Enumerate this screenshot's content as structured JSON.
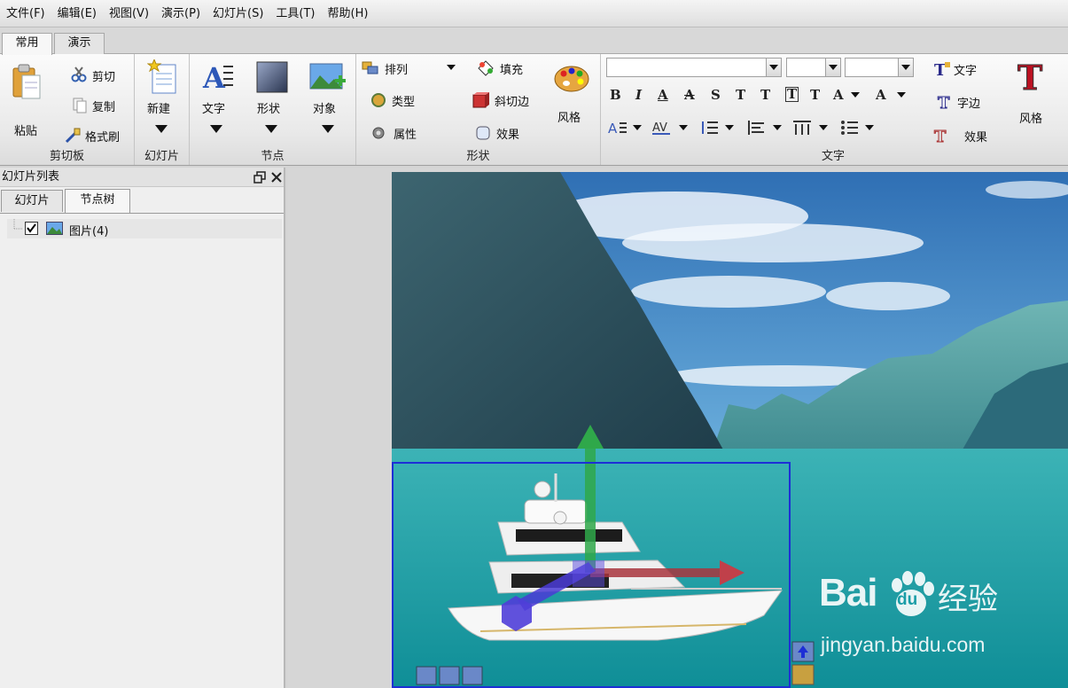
{
  "menu": [
    "文件(F)",
    "编辑(E)",
    "视图(V)",
    "演示(P)",
    "幻灯片(S)",
    "工具(T)",
    "帮助(H)"
  ],
  "ribbon_tabs": [
    "常用",
    "演示"
  ],
  "groups": {
    "clipboard": {
      "label": "剪切板",
      "paste": "粘贴",
      "cut": "剪切",
      "copy": "复制",
      "format_painter": "格式刷"
    },
    "slide": {
      "label": "幻灯片",
      "new": "新建"
    },
    "node": {
      "label": "节点",
      "text": "文字",
      "shape": "形状",
      "object": "对象"
    },
    "shape": {
      "label": "形状",
      "arrange": "排列",
      "type": "类型",
      "properties": "属性",
      "fill": "填充",
      "bevel": "斜切边",
      "effect": "效果",
      "style": "风格"
    },
    "text": {
      "label": "文字",
      "text_btn": "文字",
      "edge": "字边",
      "effect": "效果",
      "style": "风格"
    }
  },
  "format_buttons": [
    "B",
    "I",
    "A",
    "A",
    "S",
    "T",
    "T",
    "T",
    "T",
    "A",
    "A"
  ],
  "panel": {
    "title": "幻灯片列表",
    "tabs": [
      "幻灯片",
      "节点树"
    ],
    "tree_item": "图片(4)"
  },
  "watermark": {
    "brand": "Bai",
    "brand2": "du",
    "suffix": "经验",
    "url": "jingyan.baidu.com"
  },
  "colors": {
    "sky": "#3a7fc0",
    "water": "#1a9ea8",
    "selection": "#1d2fd6"
  }
}
